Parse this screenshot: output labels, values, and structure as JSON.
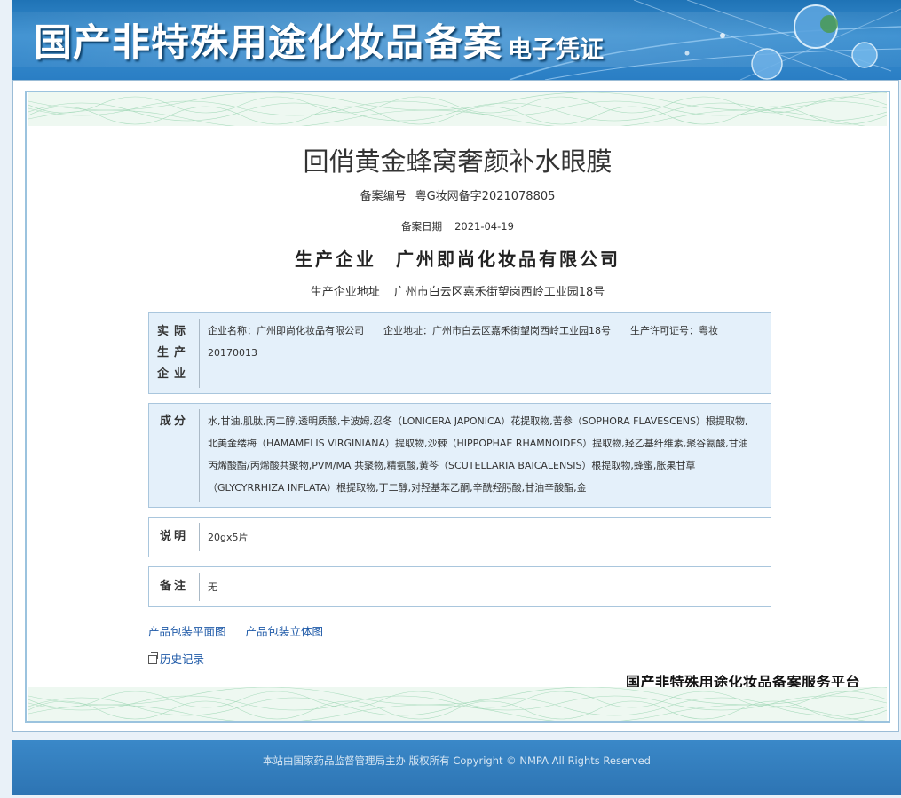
{
  "banner": {
    "title": "国产非特殊用途化妆品备案",
    "subtitle": "电子凭证"
  },
  "certificate": {
    "product_name": "回俏黄金蜂窝奢颜补水眼膜",
    "record_no_label": "备案编号",
    "record_no": "粤G妆网备字2021078805",
    "record_date_label": "备案日期",
    "record_date": "2021-04-19",
    "producer_label": "生产企业",
    "producer": "广州即尚化妆品有限公司",
    "producer_addr_label": "生产企业地址",
    "producer_addr": "广州市白云区嘉禾街望岗西岭工业园18号"
  },
  "sections": {
    "actual_producer": {
      "label": "实际生产企业",
      "name_label": "企业名称：",
      "name": "广州即尚化妆品有限公司",
      "addr_label": "企业地址：",
      "addr": "广州市白云区嘉禾街望岗西岭工业园18号",
      "license_label": "生产许可证号：",
      "license": "粤妆20170013"
    },
    "ingredients": {
      "label": "成分",
      "value": "水,甘油,肌肽,丙二醇,透明质酸,卡波姆,忍冬（LONICERA JAPONICA）花提取物,苦参（SOPHORA FLAVESCENS）根提取物,北美金缕梅（HAMAMELIS VIRGINIANA）提取物,沙棘（HIPPOPHAE RHAMNOIDES）提取物,羟乙基纤维素,聚谷氨酸,甘油丙烯酸酯/丙烯酸共聚物,PVM/MA 共聚物,精氨酸,黄芩（SCUTELLARIA BAICALENSIS）根提取物,蜂蜜,胀果甘草（GLYCYRRHIZA INFLATA）根提取物,丁二醇,对羟基苯乙酮,辛酰羟肟酸,甘油辛酸酯,金"
    },
    "description": {
      "label": "说明",
      "value": "20gx5片"
    },
    "remark": {
      "label": "备注",
      "value": "无"
    }
  },
  "links": {
    "flat_image": "产品包装平面图",
    "3d_image": "产品包装立体图",
    "history": "历史记录"
  },
  "platform_name": "国产非特殊用途化妆品备案服务平台",
  "footer": "本站由国家药品监督管理局主办 版权所有 Copyright © NMPA All Rights Reserved",
  "colors": {
    "banner": "#2a7ec4",
    "link": "#1f5aa8",
    "box_blue": "#e4f0fa",
    "border": "#9bc3de"
  }
}
